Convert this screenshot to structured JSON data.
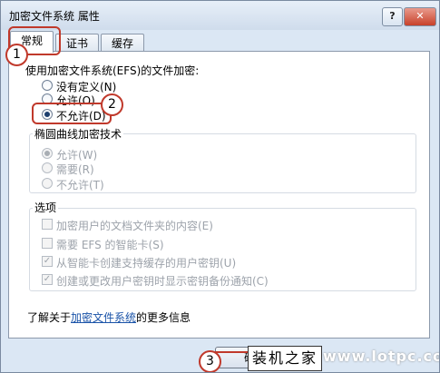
{
  "window": {
    "title": "加密文件系统 属性",
    "help_label": "?",
    "close_label": "✕"
  },
  "tabs": [
    {
      "label": "常规"
    },
    {
      "label": "证书"
    },
    {
      "label": "缓存"
    }
  ],
  "efs": {
    "heading": "使用加密文件系统(EFS)的文件加密:",
    "options": [
      {
        "label": "没有定义(N)",
        "checked": false
      },
      {
        "label": "允许(O)",
        "checked": false
      },
      {
        "label": "不允许(D)",
        "checked": true
      }
    ]
  },
  "ecc": {
    "heading": "椭圆曲线加密技术",
    "options": [
      {
        "label": "允许(W)",
        "checked": true
      },
      {
        "label": "需要(R)",
        "checked": false
      },
      {
        "label": "不允许(T)",
        "checked": false
      }
    ]
  },
  "options_group": {
    "heading": "选项",
    "items": [
      {
        "label": "加密用户的文档文件夹的内容(E)",
        "checked": false
      },
      {
        "label": "需要 EFS 的智能卡(S)",
        "checked": false
      },
      {
        "label": "从智能卡创建支持缓存的用户密钥(U)",
        "checked": true
      },
      {
        "label": "创建或更改用户密钥时显示密钥备份通知(C)",
        "checked": true
      }
    ]
  },
  "footer": {
    "prefix": "了解关于",
    "link": "加密文件系统",
    "suffix": "的更多信息"
  },
  "buttons": {
    "ok_label": "确"
  },
  "callouts": {
    "one": "1",
    "two": "2",
    "three": "3"
  },
  "watermark": {
    "brand": "装机之家",
    "domain": "www.lotpc.com"
  },
  "colors": {
    "annotation_red": "#c0392b",
    "link_blue": "#1a53a8"
  }
}
